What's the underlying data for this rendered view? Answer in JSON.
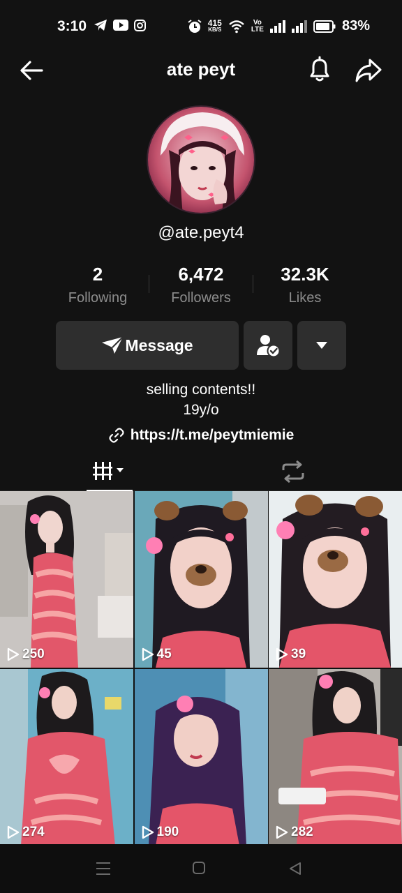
{
  "status_bar": {
    "time": "3:10",
    "net_speed_value": "415",
    "net_speed_unit": "KB/S",
    "volte_top": "Vo",
    "volte_bottom": "LTE",
    "battery": "83%"
  },
  "header": {
    "title": "ate peyt"
  },
  "profile": {
    "username": "@ate.peyt4",
    "stats": [
      {
        "value": "2",
        "label": "Following"
      },
      {
        "value": "6,472",
        "label": "Followers"
      },
      {
        "value": "32.3K",
        "label": "Likes"
      }
    ],
    "message_label": "Message",
    "bio_line1": "selling contents!!",
    "bio_line2": "19y/o",
    "link": "https://t.me/peytmiemie"
  },
  "videos": [
    {
      "views": "250"
    },
    {
      "views": "45"
    },
    {
      "views": "39"
    },
    {
      "views": "274"
    },
    {
      "views": "190"
    },
    {
      "views": "282"
    }
  ],
  "colors": {
    "background": "#121212",
    "button": "#2e2e2e",
    "muted_text": "#8c8c8c"
  },
  "icons": [
    "back-arrow-icon",
    "bell-icon",
    "share-icon",
    "telegram-icon",
    "youtube-icon",
    "instagram-icon",
    "link-icon",
    "video-grid-icon",
    "repost-icon",
    "follow-check-icon",
    "caret-down-icon",
    "play-icon"
  ]
}
